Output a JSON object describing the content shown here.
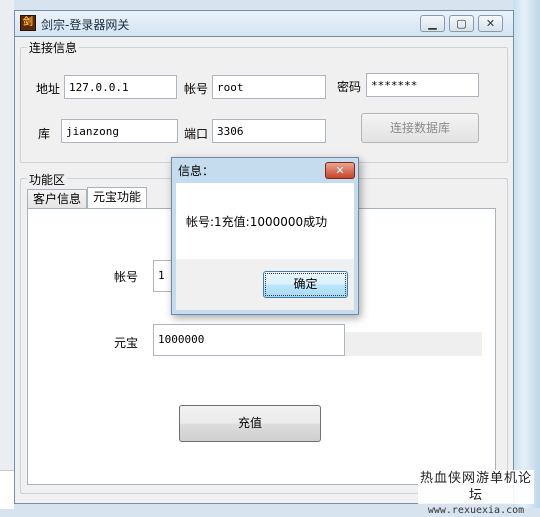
{
  "window": {
    "title": "剑宗-登录器网关",
    "icon": "app-logo-icon",
    "controls": {
      "minimize": "minimize-icon",
      "maximize": "maximize-icon",
      "close": "close-icon"
    }
  },
  "connection": {
    "legend": "连接信息",
    "address_label": "地址",
    "address_value": "127.0.0.1",
    "account_label": "帐号",
    "account_value": "root",
    "password_label": "密码",
    "password_value": "*******",
    "db_label": "库",
    "db_value": "jianzong",
    "port_label": "端口",
    "port_value": "3306",
    "connect_button": "连接数据库"
  },
  "functions": {
    "legend": "功能区",
    "tabs": [
      {
        "label": "客户信息",
        "active": false
      },
      {
        "label": "元宝功能",
        "active": true
      }
    ],
    "account_label": "帐号",
    "account_value": "1",
    "yuanbao_label": "元宝",
    "yuanbao_value": "1000000",
    "recharge_button": "充值"
  },
  "dialog": {
    "title": "信息：",
    "message": "帐号:1充值:1000000成功",
    "ok_button": "确定",
    "close_icon": "close-icon"
  },
  "watermark": {
    "line1": "热血侠网游单机论坛",
    "line2": "www.rexuexia.com"
  },
  "colors": {
    "dialog_frame": "#c4dcee",
    "close_red": "#c7452b",
    "ok_blue": "#bee6fd"
  }
}
